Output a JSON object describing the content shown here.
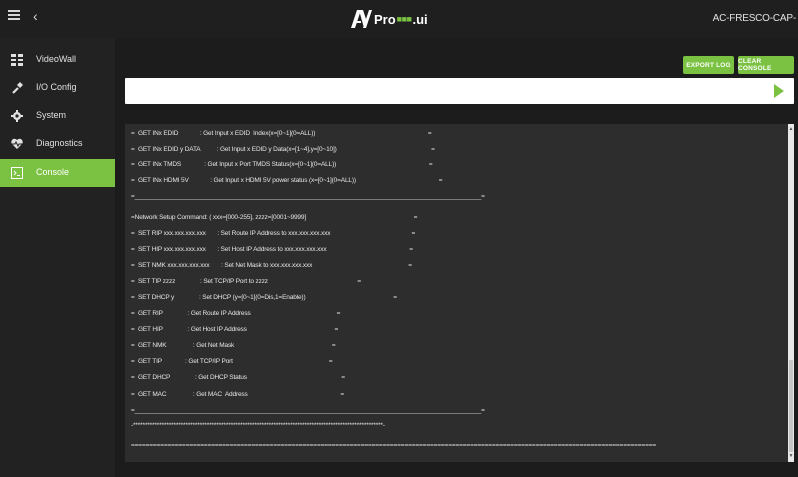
{
  "header": {
    "brand_pro": "Pro",
    "brand_dot": "■■■",
    "brand_ui": ".ui",
    "device_name": "AC-FRESCO-CAP-"
  },
  "sidebar": {
    "items": [
      {
        "label": "VideoWall",
        "icon": "grid-icon"
      },
      {
        "label": "I/O Config",
        "icon": "io-config-icon"
      },
      {
        "label": "System",
        "icon": "gear-icon"
      },
      {
        "label": "Diagnostics",
        "icon": "heartbeat-icon"
      },
      {
        "label": "Console",
        "icon": "terminal-icon",
        "active": true
      }
    ]
  },
  "toolbar": {
    "export_label": "EXPORT LOG",
    "clear_label": "CLEAR CONSOLE"
  },
  "command_input": {
    "value": "",
    "placeholder": ""
  },
  "console": {
    "lines": [
      "=  GET INx EDID             : Get Input x EDID  Index(x=[0~1](0=ALL))                                                                    =",
      "=  GET INx EDID y DATA          : Get Input x EDID y Data(x=[1~4],y=[0~10])                                                         =",
      "=  GET INx TMDS              : Get Input x Port TMDS Status(x=[0~1](0=ALL))                                                        =",
      "=  GET INx HDMI 5V             : Get Input x HDMI 5V power status (x=[0~1](0=ALL))                                                  =",
      "=____________________________________________________________________________________________________=",
      "=Network Setup Command: ( xxx=[000-255], zzzz=[0001~9999]                                                                 =",
      "=  SET RIP xxx.xxx.xxx.xxx       : Set Route IP Address to xxx.xxx.xxx.xxx                                                 =",
      "=  SET HIP xxx.xxx.xxx.xxx       : Set Host IP Address to xxx.xxx.xxx.xxx                                                  =",
      "=  SET NMK xxx.xxx.xxx.xxx       : Set Net Mask to xxx.xxx.xxx.xxx                                                          =",
      "=  SET TIP zzzz               : Set TCP/IP Port to zzzz                                                      =",
      "=  SET DHCP y               : Set DHCP (y=[0~1](0=Dis,1=Enable))                                                     =",
      "=  GET RIP               : Get Route IP Address                                                    =",
      "=  GET HIP               : Get Host IP Address                                                     =",
      "=  GET NMK                : Get Net Mask                                                           =",
      "=  GET TIP              : Get TCP/IP Port                                                          =",
      "=  GET DHCP               : Get DHCP Status                                                         =",
      "=  GET MAC                : Get MAC  Address                                                        =",
      "=____________________________________________________________________________________________________=",
      "-*********************************************************************************************************-",
      "================================================================================================================================================"
    ]
  }
}
